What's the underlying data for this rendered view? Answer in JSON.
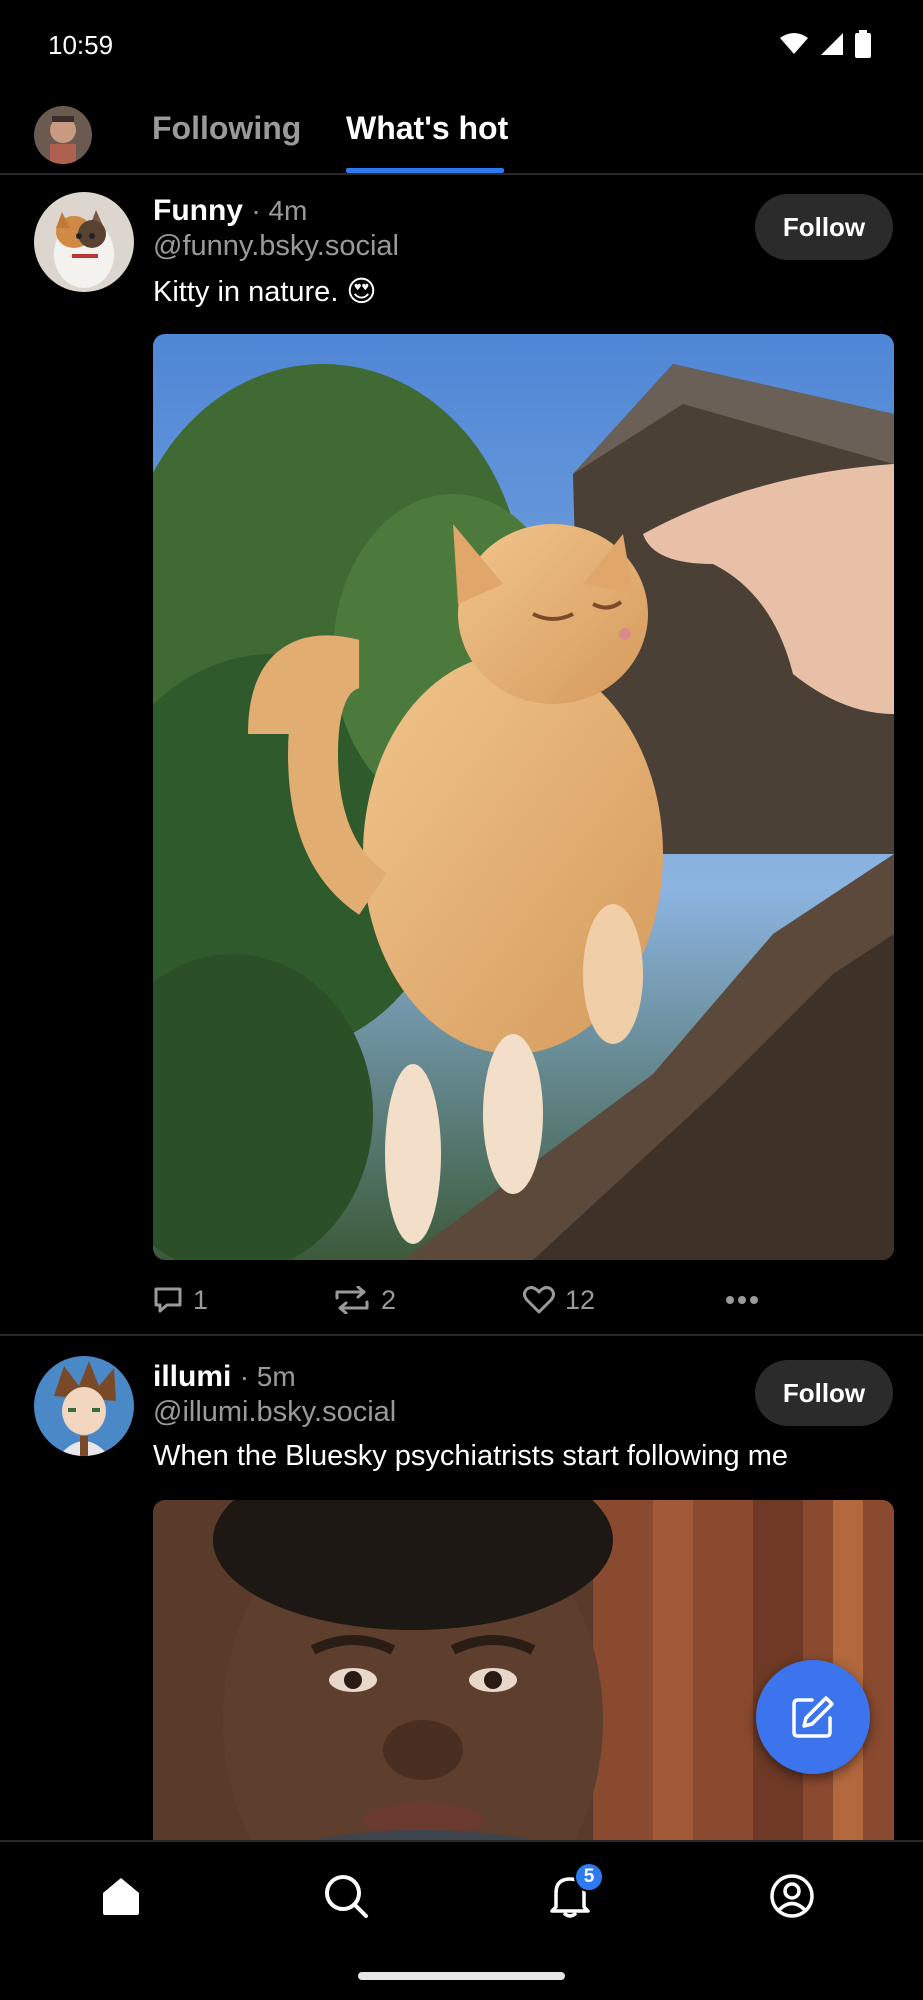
{
  "status": {
    "time": "10:59"
  },
  "tabs": {
    "following": "Following",
    "whats_hot": "What's hot"
  },
  "posts": [
    {
      "name": "Funny",
      "time": "· 4m",
      "handle": "@funny.bsky.social",
      "text": "Kitty in nature. 😍",
      "follow_label": "Follow",
      "image_alt": "orange kitten on tree trunk",
      "replies": "1",
      "reposts": "2",
      "likes": "12"
    },
    {
      "name": "illumi",
      "time": "· 5m",
      "handle": "@illumi.bsky.social",
      "text": "When the Bluesky psychiatrists start following me",
      "follow_label": "Follow",
      "image_alt": "sweating man meme"
    }
  ],
  "nav": {
    "notifications_badge": "5"
  },
  "colors": {
    "accent": "#2d7bf2",
    "fab": "#3c74ee",
    "background": "#000000",
    "muted": "#9a9a9a"
  }
}
